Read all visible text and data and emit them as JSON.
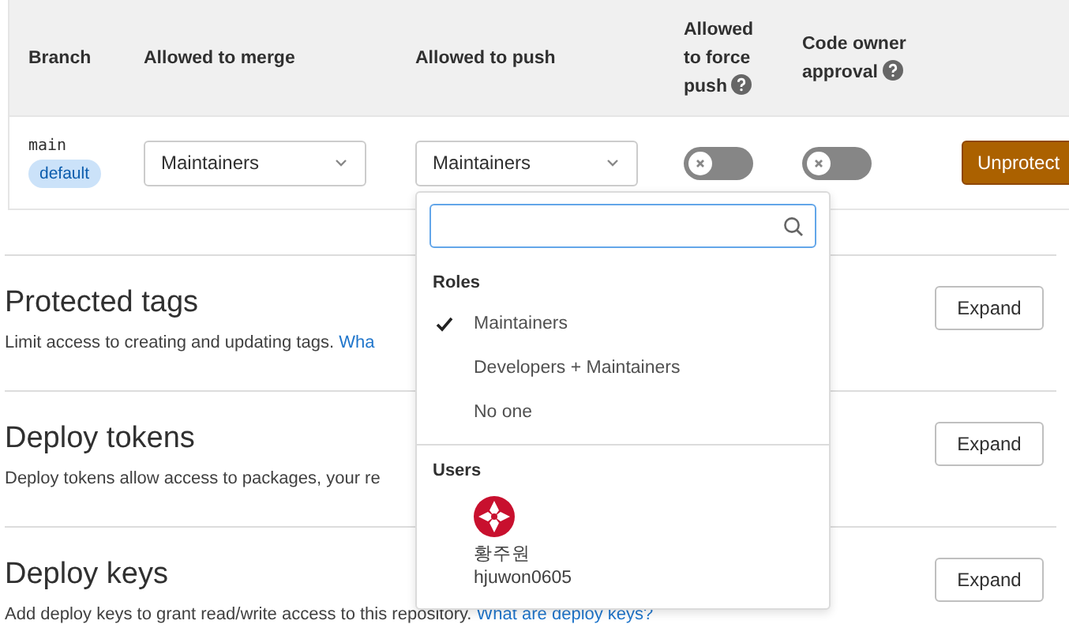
{
  "table": {
    "columns": [
      {
        "label": "Branch",
        "help": false
      },
      {
        "label": "Allowed to merge",
        "help": false
      },
      {
        "label": "Allowed to push",
        "help": false
      },
      {
        "label": "Allowed to force push",
        "help": true
      },
      {
        "label": "Code owner approval",
        "help": true
      }
    ],
    "rows": [
      {
        "branch": "main",
        "badge": "default",
        "merge": "Maintainers",
        "push": "Maintainers",
        "force_push": false,
        "code_owner": false,
        "action": "Unprotect"
      }
    ]
  },
  "sections": [
    {
      "title": "Protected tags",
      "description": "Limit access to creating and updating tags.",
      "link": "Wha",
      "button": "Expand"
    },
    {
      "title": "Deploy tokens",
      "description": "Deploy tokens allow access to packages, your re",
      "button": "Expand"
    },
    {
      "title": "Deploy keys",
      "description": "Add deploy keys to grant read/write access to this repository.",
      "link": "What are deploy keys?",
      "button": "Expand"
    }
  ],
  "dropdown": {
    "roles_label": "Roles",
    "roles": [
      {
        "label": "Maintainers",
        "selected": true
      },
      {
        "label": "Developers + Maintainers",
        "selected": false
      },
      {
        "label": "No one",
        "selected": false
      }
    ],
    "users_label": "Users",
    "users": [
      {
        "name": "황주원",
        "username": "hjuwon0605"
      }
    ]
  }
}
